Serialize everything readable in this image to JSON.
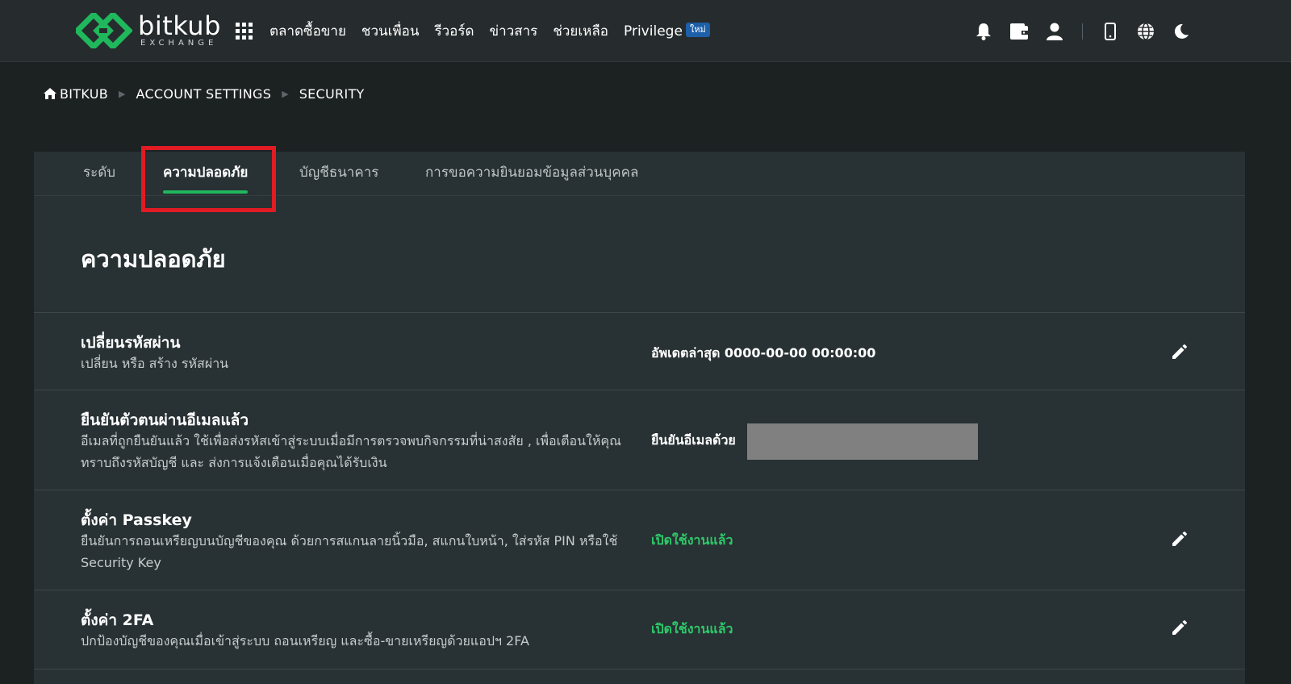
{
  "colors": {
    "accent": "#1fb85d",
    "status_green": "#2ec86a",
    "highlight_red": "#e01b24",
    "badge_blue": "#1d5fa8"
  },
  "brand": {
    "name": "bitkub",
    "sub": "EXCHANGE"
  },
  "nav": {
    "links": [
      "ตลาดซื้อขาย",
      "ชวนเพื่อน",
      "รีวอร์ด",
      "ข่าวสาร",
      "ช่วยเหลือ",
      "Privilege"
    ],
    "new_badge": "ใหม่",
    "icons": [
      "apps-grid-icon",
      "bell-icon",
      "wallet-icon",
      "user-icon",
      "mobile-icon",
      "globe-icon",
      "moon-icon"
    ]
  },
  "breadcrumb": [
    "BITKUB",
    "ACCOUNT SETTINGS",
    "SECURITY"
  ],
  "tabs": [
    "ระดับ",
    "ความปลอดภัย",
    "บัญชีธนาคาร",
    "การขอความยินยอมข้อมูลส่วนบุคคล"
  ],
  "active_tab": "ความปลอดภัย",
  "section_title": "ความปลอดภัย",
  "rows": [
    {
      "title": "เปลี่ยนรหัสผ่าน",
      "desc": "เปลี่ยน หรือ สร้าง รหัสผ่าน",
      "status": "อัพเดตล่าสุด 0000-00-00 00:00:00"
    },
    {
      "title": "ยืนยันตัวตนผ่านอีเมลแล้ว",
      "desc": "อีเมลที่ถูกยืนยันแล้ว ใช้เพื่อส่งรหัสเข้าสู่ระบบเมื่อมีการตรวจพบกิจกรรมที่น่าสงสัย , เพื่อเตือนให้คุณทราบถึงรหัสบัญชี และ ส่งการแจ้งเตือนเมื่อคุณได้รับเงิน",
      "status": "ยืนยันอีเมลด้วย"
    },
    {
      "title": "ตั้งค่า Passkey",
      "desc": "ยืนยันการถอนเหรียญบนบัญชีของคุณ ด้วยการสแกนลายนิ้วมือ, สแกนใบหน้า, ใส่รหัส PIN หรือใช้ Security Key",
      "status": "เปิดใช้งานแล้ว"
    },
    {
      "title": "ตั้งค่า 2FA",
      "desc": "ปกป้องบัญชีของคุณเมื่อเข้าสู่ระบบ ถอนเหรียญ และซื้อ-ขายเหรียญด้วยแอปฯ 2FA",
      "status": "เปิดใช้งานแล้ว"
    }
  ]
}
